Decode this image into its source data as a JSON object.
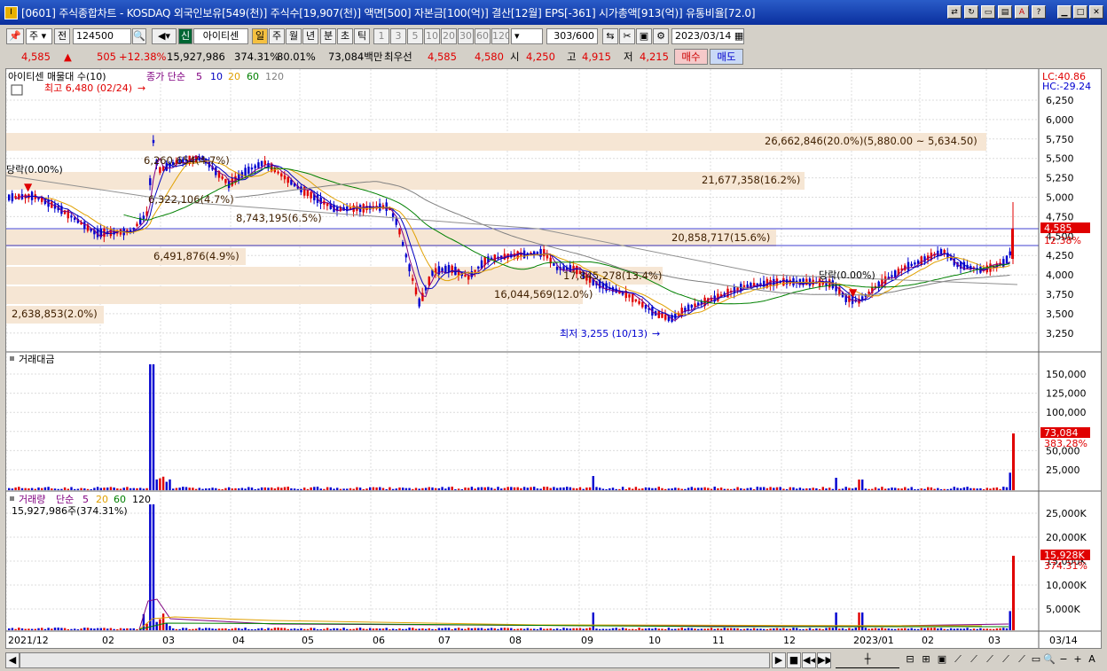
{
  "window": {
    "title": "[0601] 주식종합차트 - KOSDAQ 외국인보유[549(천)] 주식수[19,907(천)] 액면[500] 자본금[100(억)] 결산[12월] EPS[-361] 시가총액[913(억)] 유통비율[72.0]",
    "app_icon": "I"
  },
  "toolbar": {
    "period_select": "주",
    "prev_label": "전",
    "code_value": "124500",
    "badge_new": "신",
    "stock_name": "아이티센",
    "period_tabs": [
      "일",
      "주",
      "월",
      "년",
      "분",
      "초",
      "틱"
    ],
    "active_period": "일",
    "minute_tabs": [
      "1",
      "3",
      "5",
      "10",
      "20",
      "30",
      "60",
      "120"
    ],
    "count_value": "303/600",
    "date_value": "2023/03/14"
  },
  "quote": {
    "price": "4,585",
    "change_arrow": "▲",
    "change": "505",
    "change_pct": "+12.38%",
    "volume": "15,927,986",
    "volume_ratio": "374.31%",
    "turnover": "80.01%",
    "amount": "73,084백만",
    "best_bid_label": "최우선",
    "ask": "4,585",
    "bid": "4,580",
    "open_label": "시",
    "open": "4,250",
    "high_label": "고",
    "high": "4,915",
    "low_label": "저",
    "low": "4,215",
    "buy_label": "매수",
    "sell_label": "매도"
  },
  "price_panel": {
    "legend_name": "아이티센 매물대 수(10)",
    "legend_ma": "종가 단순",
    "ma_periods": [
      "5",
      "10",
      "20",
      "60",
      "120"
    ],
    "max_label": "최고 6,480 (02/24)",
    "min_label": "최저 3,255 (10/13)",
    "lc_label": "LC:40.86",
    "hc_label": "HC:-29.24",
    "current_price_tag": "4,585",
    "current_pct_tag": "12.38%",
    "y_ticks": [
      "6,250",
      "6,000",
      "5,750",
      "5,500",
      "5,250",
      "5,000",
      "4,750",
      "4,500",
      "4,250",
      "4,000",
      "3,750",
      "3,500",
      "3,250"
    ],
    "profile_labels": [
      "26,662,846(20.0%)(5,880.00 ~ 5,634.50)",
      "21,677,358(16.2%)",
      "20,858,717(15.6%)",
      "6,491,876(4.9%)",
      "16,044,569(12.0%)",
      "2,638,853(2.0%)",
      "8,743,195(6.5%)",
      "6,322,106(4.7%)",
      "6,260,654(4.7%)",
      "17,845,278(13.4%)"
    ],
    "line_labels": [
      "당락(0.00%)",
      "당락(0.00%)"
    ]
  },
  "amount_panel": {
    "title": "거래대금",
    "y_ticks": [
      "150,000",
      "125,000",
      "100,000",
      "75,000",
      "50,000",
      "25,000"
    ],
    "current_tag": "73,084",
    "current_pct_tag": "383.28%"
  },
  "volume_panel": {
    "title": "거래량",
    "ma_label": "단순",
    "ma_periods": [
      "5",
      "20",
      "60",
      "120"
    ],
    "value_label": "15,927,986주(374.31%)",
    "y_ticks": [
      "25,000K",
      "20,000K",
      "15,000K",
      "10,000K",
      "5,000K"
    ],
    "current_tag": "15,928K",
    "current_pct_tag": "374.31%"
  },
  "x_axis": {
    "labels": [
      "2021/12",
      "02",
      "03",
      "04",
      "05",
      "06",
      "07",
      "08",
      "09",
      "10",
      "11",
      "12",
      "2023/01",
      "02",
      "03"
    ],
    "right_label": "03/14"
  },
  "colors": {
    "up": "#e00000",
    "down": "#0000d0",
    "ma5": "#800080",
    "ma10": "#0000c0",
    "ma20": "#e0a000",
    "ma60": "#008000",
    "ma120": "#808080",
    "profile": "#f6e6d4"
  },
  "bottom": {
    "zoom_minus": "−",
    "zoom_plus": "+",
    "font_a": "A"
  }
}
